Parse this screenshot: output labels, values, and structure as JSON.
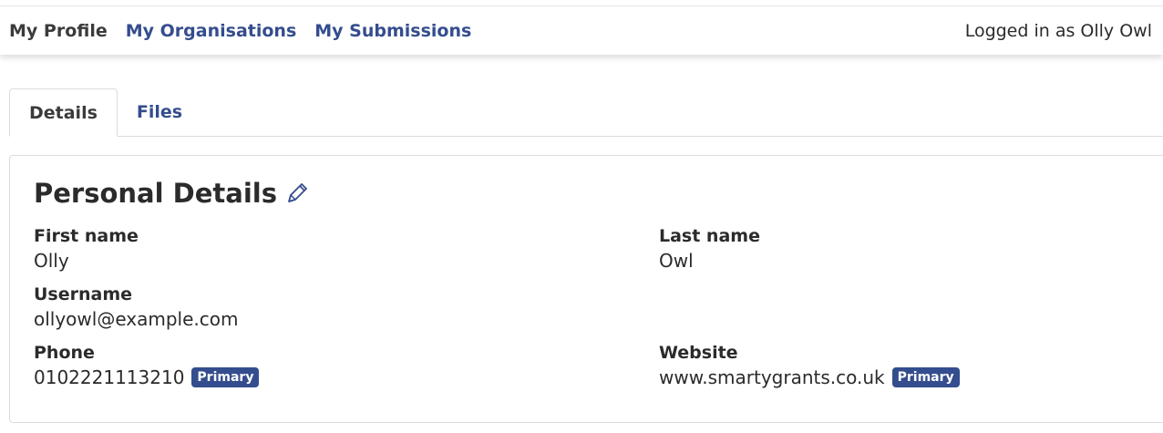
{
  "nav": {
    "links": [
      {
        "label": "My Profile",
        "active": true
      },
      {
        "label": "My Organisations",
        "active": false
      },
      {
        "label": "My Submissions",
        "active": false
      }
    ],
    "logged_in_text": "Logged in as Olly Owl"
  },
  "tabs": [
    {
      "label": "Details",
      "active": true
    },
    {
      "label": "Files",
      "active": false
    }
  ],
  "details": {
    "title": "Personal Details",
    "first_name": {
      "label": "First name",
      "value": "Olly"
    },
    "last_name": {
      "label": "Last name",
      "value": "Owl"
    },
    "username": {
      "label": "Username",
      "value": "ollyowl@example.com"
    },
    "phone": {
      "label": "Phone",
      "value": "0102221113210",
      "badge": "Primary"
    },
    "website": {
      "label": "Website",
      "value": "www.smartygrants.co.uk",
      "badge": "Primary"
    }
  },
  "colors": {
    "accent": "#344d8e",
    "text": "#2b2b2b",
    "border": "#dcdcdc"
  },
  "icons": {
    "edit": "pencil-icon"
  }
}
